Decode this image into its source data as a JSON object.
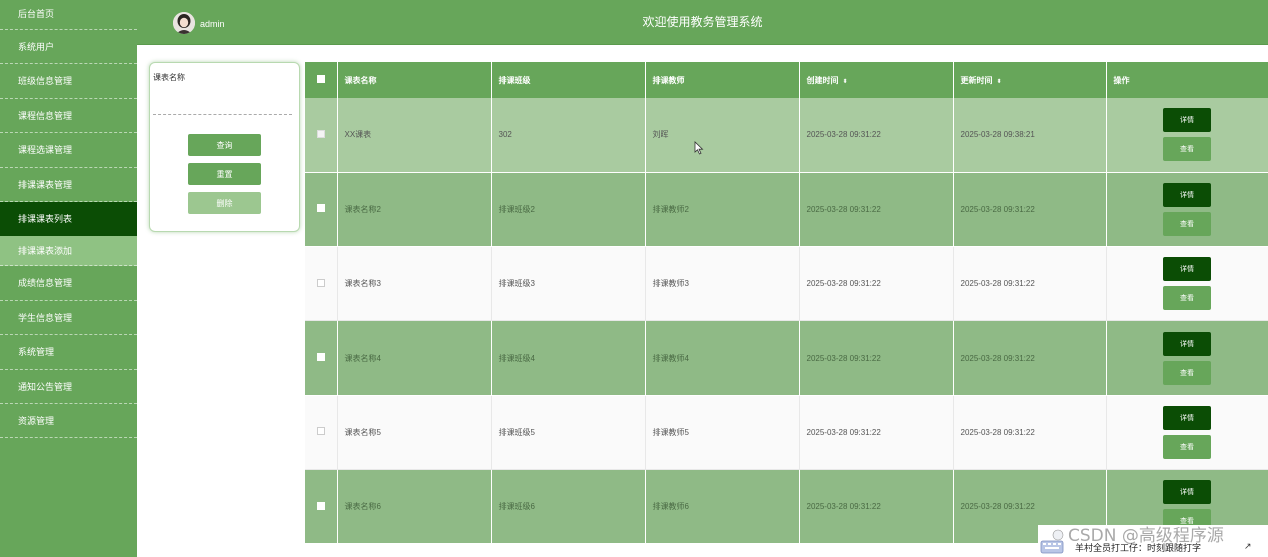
{
  "sidebar": {
    "items": [
      {
        "label": "后台首页"
      },
      {
        "label": "系统用户"
      },
      {
        "label": "班级信息管理"
      },
      {
        "label": "课程信息管理"
      },
      {
        "label": "课程选课管理"
      },
      {
        "label": "排课课表管理"
      },
      {
        "label": "排课课表列表"
      },
      {
        "label": "排课课表添加"
      },
      {
        "label": "成绩信息管理"
      },
      {
        "label": "学生信息管理"
      },
      {
        "label": "系统管理"
      },
      {
        "label": "通知公告管理"
      },
      {
        "label": "资源管理"
      }
    ]
  },
  "header": {
    "user": "admin",
    "title": "欢迎使用教务管理系统"
  },
  "search": {
    "label": "课表名称",
    "query_label": "查询",
    "reset_label": "重置",
    "delete_label": "删除"
  },
  "table": {
    "columns": [
      "课表名称",
      "排课班级",
      "排课教师",
      "创建时间",
      "更新时间",
      "操作"
    ],
    "sort_glyph": "⬍",
    "detail_label": "详情",
    "view_label": "查看",
    "rows": [
      {
        "name": "XX课表",
        "cls": "302",
        "teacher": "刘晖",
        "created": "2025-03-28 09:31:22",
        "updated": "2025-03-28 09:38:21"
      },
      {
        "name": "课表名称2",
        "cls": "排课班级2",
        "teacher": "排课教师2",
        "created": "2025-03-28 09:31:22",
        "updated": "2025-03-28 09:31:22"
      },
      {
        "name": "课表名称3",
        "cls": "排课班级3",
        "teacher": "排课教师3",
        "created": "2025-03-28 09:31:22",
        "updated": "2025-03-28 09:31:22"
      },
      {
        "name": "课表名称4",
        "cls": "排课班级4",
        "teacher": "排课教师4",
        "created": "2025-03-28 09:31:22",
        "updated": "2025-03-28 09:31:22"
      },
      {
        "name": "课表名称5",
        "cls": "排课班级5",
        "teacher": "排课教师5",
        "created": "2025-03-28 09:31:22",
        "updated": "2025-03-28 09:31:22"
      },
      {
        "name": "课表名称6",
        "cls": "排课班级6",
        "teacher": "排课教师6",
        "created": "2025-03-28 09:31:22",
        "updated": "2025-03-28 09:31:22"
      }
    ]
  },
  "watermark": {
    "text": "CSDN @高级程序源",
    "subtext": "羊村全员打工仔：时刻跟随打字",
    "arrow": "↗"
  },
  "colors": {
    "primary": "#67a65a",
    "active": "#0b4d05",
    "row_green": "#8fba86"
  }
}
